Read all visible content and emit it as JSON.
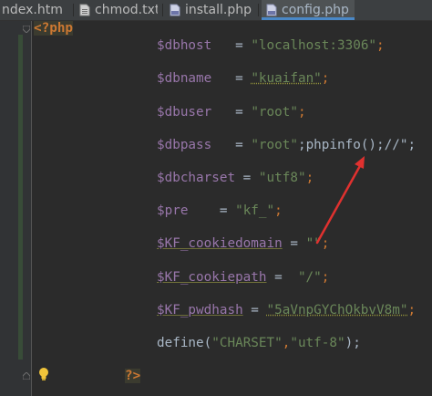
{
  "tabs": [
    {
      "label": "ndex.htm",
      "active": false
    },
    {
      "label": "chmod.txt",
      "active": false
    },
    {
      "label": "install.php",
      "active": false
    },
    {
      "label": "config.php",
      "active": true
    }
  ],
  "code": {
    "open_tag": "<?php",
    "close_tag": "?>",
    "line_dbhost": {
      "var": "$dbhost",
      "op": "   = ",
      "value": "\"localhost:3306\"",
      "end": ";"
    },
    "line_dbname": {
      "var": "$dbname",
      "op": "   = ",
      "value": "\"kuaifan\"",
      "end": ";"
    },
    "line_dbuser": {
      "var": "$dbuser",
      "op": "   = ",
      "value": "\"root\"",
      "end": ";"
    },
    "line_dbpass": {
      "var": "$dbpass",
      "op": "   = ",
      "value": "\"root\"",
      "end": ";phpinfo();//\";"
    },
    "line_dbcharset": {
      "var": "$dbcharset",
      "op": " = ",
      "value": "\"utf8\"",
      "end": ";"
    },
    "line_pre": {
      "var": "$pre",
      "op": "    = ",
      "value": "\"kf_\"",
      "end": ";"
    },
    "line_cookiedomain": {
      "var": "$KF_cookiedomain",
      "op": " = ",
      "value": "\"\"",
      "end": ";"
    },
    "line_cookiepath": {
      "var": "$KF_cookiepath",
      "op": " =  ",
      "value": "\"/\"",
      "end": ";"
    },
    "line_pwdhash": {
      "var": "$KF_pwdhash",
      "op": " = ",
      "value": "\"5aVnpGYChOkbvV8m\"",
      "end": ";"
    },
    "line_define": {
      "fn": "define(",
      "arg1": "\"CHARSET\"",
      "comma": ",",
      "arg2": "\"utf-8\"",
      "end": ");"
    }
  },
  "colors": {
    "variable": "#9876aa",
    "string": "#6a8759",
    "plain": "#a9b7c6",
    "keyword": "#cc7832",
    "annotation_arrow": "#e0312f"
  },
  "icons": {
    "tab_file": "php-file-icon",
    "gutter": "lightbulb-icon"
  }
}
